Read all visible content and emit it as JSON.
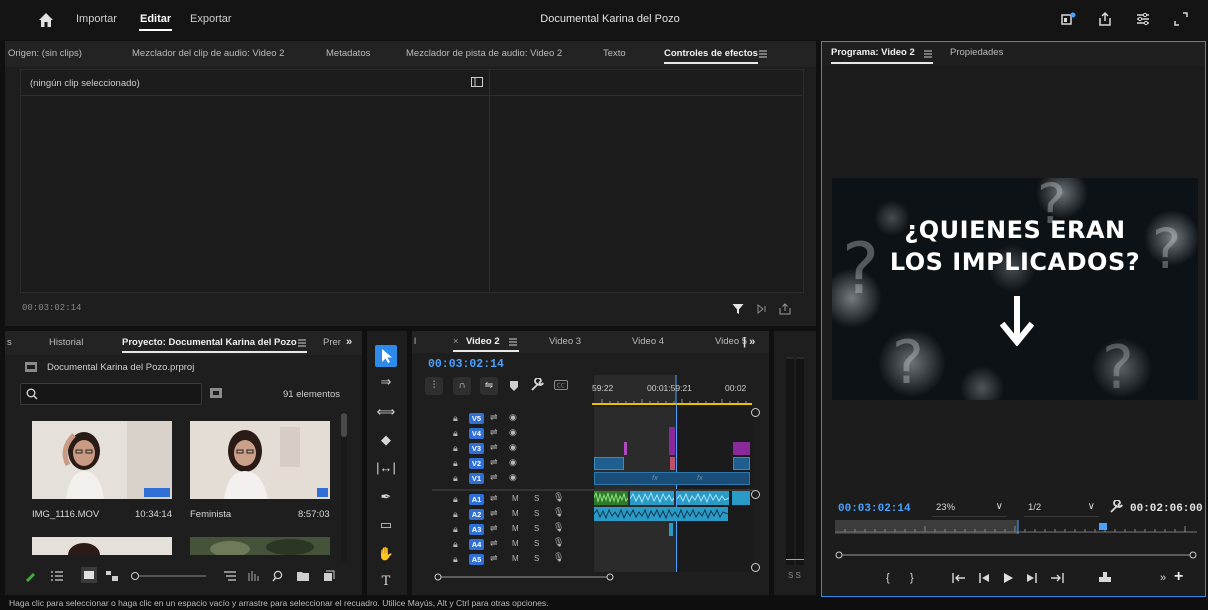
{
  "menubar": {
    "home_icon": "home-icon",
    "importar": "Importar",
    "editar": "Editar",
    "exportar": "Exportar",
    "title": "Documental Karina del Pozo"
  },
  "source_panel": {
    "tabs": [
      "Origen: (sin clips)",
      "Mezclador del clip de audio: Video 2",
      "Metadatos",
      "Mezclador de pista de audio: Video 2",
      "Texto",
      "Controles de efectos"
    ],
    "no_clip": "(ningún clip seleccionado)",
    "timecode": "00:03:02:14"
  },
  "program_panel": {
    "tab_program": "Programa: Video 2",
    "tab_properties": "Propiedades",
    "video_line1": "¿QUIENES ERAN",
    "video_line2": "LOS IMPLICADOS?",
    "timecode": "00:03:02:14",
    "zoom": "23%",
    "resolution": "1/2",
    "duration": "00:02:06:00"
  },
  "project_panel": {
    "tab_history": "Historial",
    "tab_project": "Proyecto: Documental Karina del Pozo",
    "tab_more": "Prer",
    "file": "Documental Karina del Pozo.prproj",
    "count": "91 elementos",
    "items": [
      {
        "name": "IMG_1116.MOV",
        "duration": "10:34:14"
      },
      {
        "name": "Feminista",
        "duration": "8:57:03"
      }
    ]
  },
  "timeline": {
    "tabs": [
      "Video 2",
      "Video 3",
      "Video 4",
      "Video 5"
    ],
    "close_mark": "×",
    "timecode": "00:03:02:14",
    "ruler": [
      "59:22",
      "00:01:59:21",
      "00:02"
    ],
    "video_tracks": [
      "V5",
      "V4",
      "V3",
      "V2",
      "V1"
    ],
    "audio_tracks": [
      "A1",
      "A2",
      "A3",
      "A4",
      "A5"
    ],
    "m_label": "M",
    "s_label": "S",
    "fx_label": "fx"
  },
  "meter": {
    "label": "S S"
  },
  "statusbar": {
    "text": "Haga clic para seleccionar o haga clic en un espacio vacío y arrastre para seleccionar el recuadro. Utilice Mayús, Alt y Ctrl para otras opciones."
  },
  "colors": {
    "accent": "#2d8ceb",
    "timecode": "#4aa2ff",
    "clip_blue": "#1f5f8f",
    "clip_purple": "#8a2a9a",
    "audio_clip": "#2a9ac7",
    "audio_green": "#3fae3a"
  }
}
